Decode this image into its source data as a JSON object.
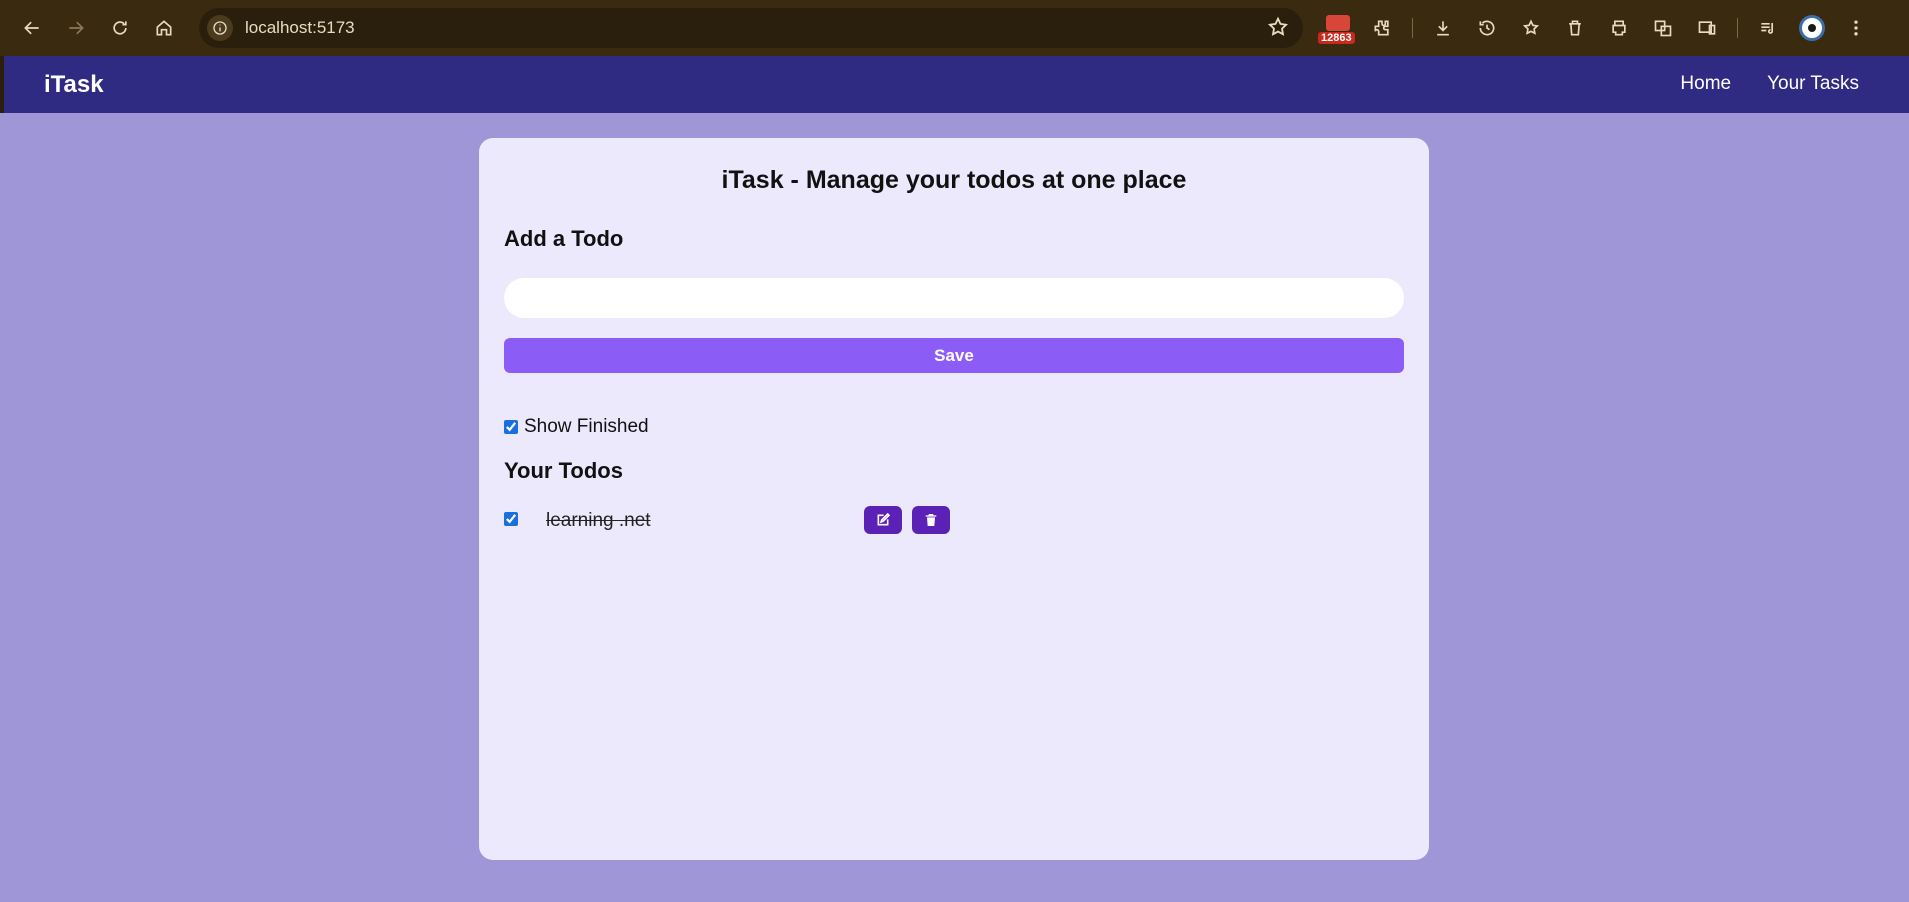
{
  "browser": {
    "url": "localhost:5173",
    "extension_badge": "12863"
  },
  "app": {
    "brand": "iTask",
    "nav_links": [
      "Home",
      "Your Tasks"
    ]
  },
  "main": {
    "title": "iTask - Manage your todos at one place",
    "add_heading": "Add a Todo",
    "input_value": "",
    "save_label": "Save",
    "show_finished_label": "Show Finished",
    "show_finished_checked": true,
    "todos_heading": "Your Todos",
    "todos": [
      {
        "text": "learning .net",
        "done": true
      }
    ]
  },
  "colors": {
    "page_bg": "#9f96d8",
    "nav_bg": "#302b82",
    "card_bg": "#ede9fd",
    "save_button": "#8b5cf6",
    "icon_button": "#5b21b6"
  },
  "icons": [
    "back-icon",
    "forward-icon",
    "reload-icon",
    "home-icon",
    "info-icon",
    "star-icon",
    "extensions-icon",
    "download-icon",
    "history-icon",
    "bookmarks-icon",
    "trash-icon",
    "print-icon",
    "translate-icon",
    "devices-icon",
    "media-icon",
    "more-icon",
    "edit-icon",
    "delete-icon"
  ]
}
